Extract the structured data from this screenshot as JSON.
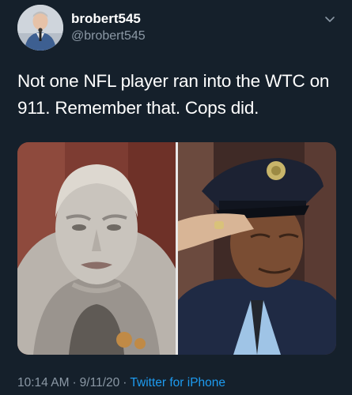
{
  "user": {
    "display_name": "brobert545",
    "handle": "@brobert545",
    "avatar_icon": "profile-photo-man-with-microphone"
  },
  "tweet": {
    "text": "Not one NFL player ran into the WTC on 911. Remember that. Cops did.",
    "media": [
      {
        "alt_icon": "photo-dust-covered-firefighter"
      },
      {
        "alt_icon": "photo-saluting-officer-in-uniform"
      }
    ]
  },
  "meta": {
    "time": "10:14 AM",
    "date": "9/11/20",
    "separator": "·",
    "source": "Twitter for iPhone"
  },
  "colors": {
    "background": "#15202b",
    "secondary_text": "#8b98a5",
    "link": "#1d9bf0"
  }
}
